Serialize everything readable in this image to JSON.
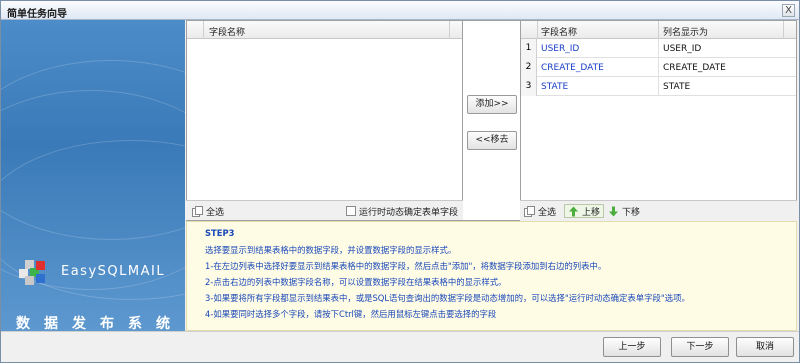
{
  "window": {
    "title": "简单任务向导",
    "close_label": "X"
  },
  "banner": {
    "brand": "EasySQLMAIL",
    "subtitle": "数据发布系统"
  },
  "left_grid": {
    "header": "字段名称",
    "rows": []
  },
  "left_toolbar": {
    "select_all": "全选",
    "runtime_checkbox_label": "运行时动态确定表单字段"
  },
  "middle": {
    "add_label": "添加>>",
    "remove_label": "<<移去"
  },
  "right_grid": {
    "headers": {
      "field": "字段名称",
      "display": "列名显示为"
    },
    "rows": [
      {
        "num": "1",
        "field": "USER_ID",
        "display": "USER_ID"
      },
      {
        "num": "2",
        "field": "CREATE_DATE",
        "display": "CREATE_DATE"
      },
      {
        "num": "3",
        "field": "STATE",
        "display": "STATE"
      }
    ]
  },
  "right_toolbar": {
    "select_all": "全选",
    "move_up": "上移",
    "move_down": "下移"
  },
  "help": {
    "step": "STEP3",
    "lines": [
      "选择要显示到结果表格中的数据字段，并设置数据字段的显示样式。",
      "1-在左边列表中选择好要显示到结果表格中的数据字段，然后点击\"添加\"，将数据字段添加到右边的列表中。",
      "2-点击右边的列表中数据字段名称，可以设置数据字段在结果表格中的显示样式。",
      "3-如果要将所有字段都显示到结果表中，或是SQL语句查询出的数据字段是动态增加的，可以选择\"运行时动态确定表单字段\"选项。",
      "4-如果要同时选择多个字段，请按下Ctrl键，然后用鼠标左键点击要选择的字段"
    ]
  },
  "footer": {
    "prev": "上一步",
    "next": "下一步",
    "cancel": "取消"
  },
  "colors": {
    "banner": "#3a7ab8",
    "link": "#1a3fc8",
    "help_bg": "#fffce6"
  }
}
